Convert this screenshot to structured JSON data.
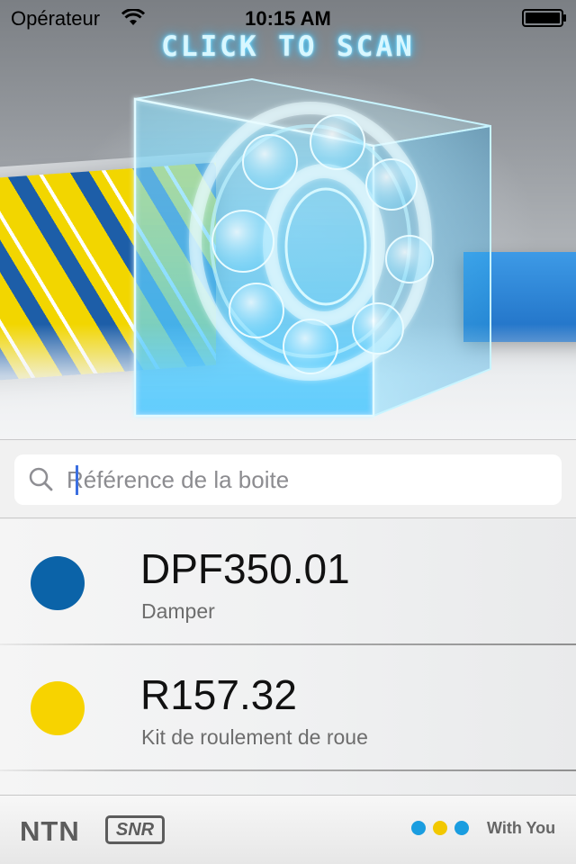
{
  "status_bar": {
    "carrier": "Opérateur",
    "time": "10:15 AM",
    "wifi_icon": "wifi-icon",
    "battery_icon": "battery-icon"
  },
  "hero": {
    "scan_label": "CLICK TO SCAN",
    "glow_color": "#5fd6ff"
  },
  "search": {
    "placeholder": "Référence de la boite",
    "value": "",
    "icon": "search-icon"
  },
  "results": [
    {
      "reference": "DPF350.01",
      "description": "Damper",
      "color": "#0b63a8"
    },
    {
      "reference": "R157.32",
      "description": "Kit de roulement de roue",
      "color": "#f7d300"
    }
  ],
  "footer": {
    "brand_ntn": "NTN",
    "brand_snr": "SNR",
    "dot_colors": [
      "#1a9de0",
      "#f2c800",
      "#1a9de0"
    ],
    "tagline": "With You"
  }
}
